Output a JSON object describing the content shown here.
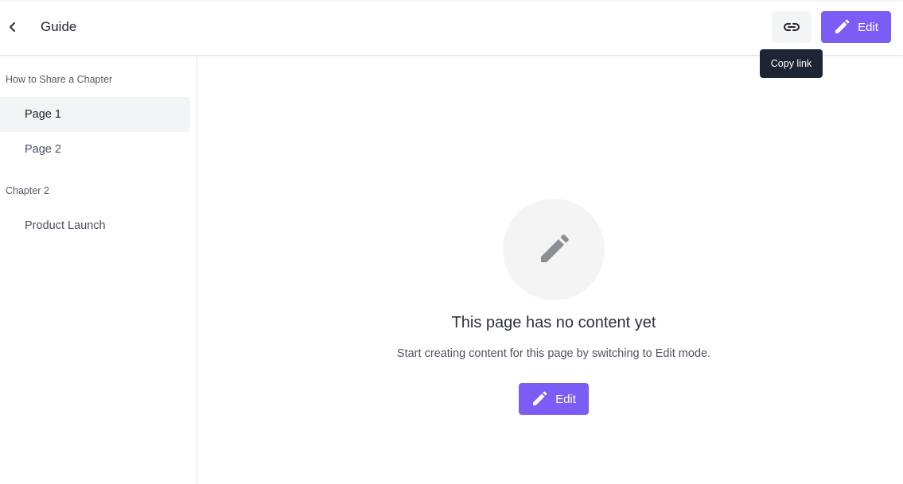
{
  "header": {
    "title": "Guide",
    "back_icon": "chevron-left-icon",
    "link_icon": "link-icon",
    "edit_label": "Edit",
    "tooltip": "Copy link"
  },
  "sidebar": {
    "chapters": [
      {
        "title": "How to Share a Chapter",
        "pages": [
          "Page 1",
          "Page 2"
        ]
      },
      {
        "title": "Chapter 2",
        "pages": [
          "Product Launch"
        ]
      }
    ],
    "active_page": "Page 1"
  },
  "main": {
    "empty_icon": "pencil-icon",
    "empty_title": "This page has no content yet",
    "empty_description": "Start creating content for this page by switching to Edit mode.",
    "edit_label": "Edit"
  },
  "colors": {
    "accent": "#7b5cf5",
    "tooltip_bg": "#1e2433",
    "active_item_bg": "#f3f4f6"
  }
}
